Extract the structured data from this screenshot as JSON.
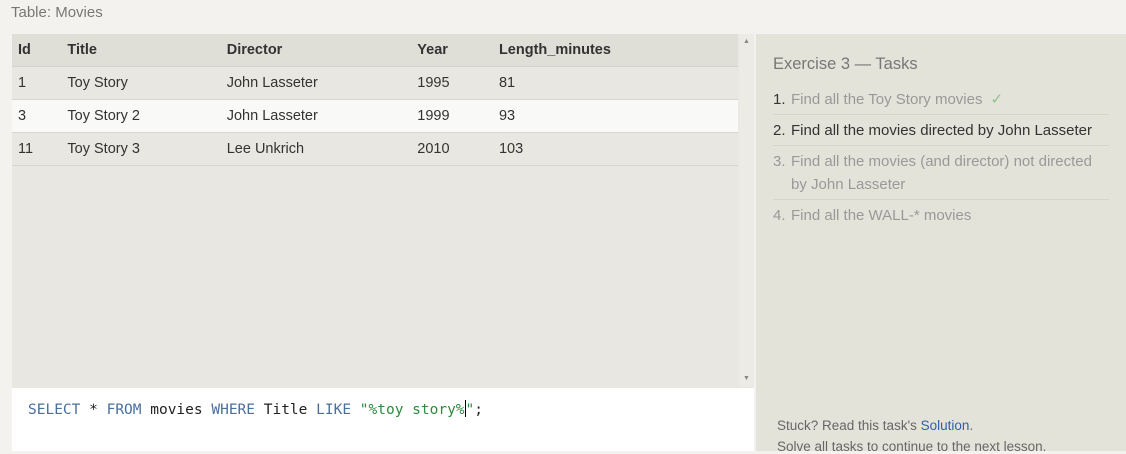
{
  "table_label": "Table: Movies",
  "table": {
    "columns": [
      "Id",
      "Title",
      "Director",
      "Year",
      "Length_minutes"
    ],
    "rows": [
      [
        "1",
        "Toy Story",
        "John Lasseter",
        "1995",
        "81"
      ],
      [
        "3",
        "Toy Story 2",
        "John Lasseter",
        "1999",
        "93"
      ],
      [
        "11",
        "Toy Story 3",
        "Lee Unkrich",
        "2010",
        "103"
      ]
    ]
  },
  "query": {
    "kw_select": "SELECT",
    "star": " * ",
    "kw_from": "FROM",
    "table_name": " movies ",
    "kw_where": "WHERE",
    "column": " Title ",
    "kw_like": "LIKE",
    "space": " ",
    "string_before_caret": "\"%toy story%",
    "string_after_caret": "\"",
    "terminator": ";"
  },
  "exercise": {
    "title": "Exercise 3 — Tasks",
    "tasks": [
      {
        "num": "1.",
        "text": "Find all the Toy Story movies",
        "check": "✓"
      },
      {
        "num": "2.",
        "text": "Find all the movies directed by John Lasseter"
      },
      {
        "num": "3.",
        "text": "Find all the movies (and director) not directed by John Lasseter"
      },
      {
        "num": "4.",
        "text": "Find all the WALL-* movies"
      }
    ]
  },
  "help": {
    "stuck_prefix": "Stuck? Read this task's ",
    "solution_link": "Solution",
    "stuck_suffix": ".",
    "solve_all": "Solve all tasks to continue to the next lesson."
  },
  "colors": {
    "keyword": "#4a6f9b",
    "string": "#2d8a3e",
    "link": "#2f5fa8",
    "check": "#8ec28e"
  },
  "icons": {
    "scroll_up": "scroll-up-arrow-icon",
    "scroll_down": "scroll-down-arrow-icon",
    "task_complete": "checkmark-icon"
  }
}
